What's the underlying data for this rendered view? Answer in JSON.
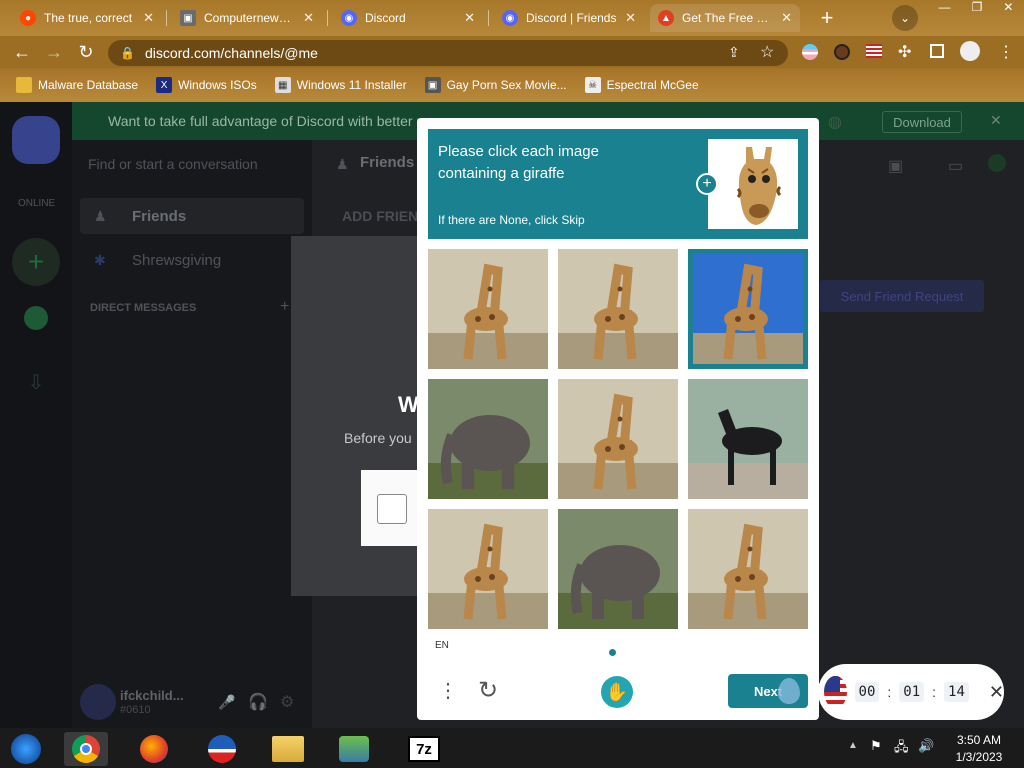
{
  "browser": {
    "tabs": [
      {
        "title": "The true, correct",
        "icon": "reddit-icon",
        "color": "#ff4500"
      },
      {
        "title": "Computernewb's I",
        "icon": "computer-icon",
        "color": "#7a7a7a"
      },
      {
        "title": "Discord",
        "icon": "discord-icon",
        "color": "#5865f2"
      },
      {
        "title": "Discord | Friends",
        "icon": "discord-icon",
        "color": "#5865f2"
      },
      {
        "title": "Get The Free and",
        "icon": "fire-icon",
        "color": "#e04020"
      }
    ],
    "url": "discord.com/channels/@me",
    "bookmarks": [
      {
        "label": "Malware Database",
        "icon": "folder-icon"
      },
      {
        "label": "Windows ISOs",
        "icon": "x-icon"
      },
      {
        "label": "Windows 11 Installer",
        "icon": "image-icon"
      },
      {
        "label": "Gay Porn Sex Movie...",
        "icon": "computer-icon"
      },
      {
        "label": "Espectral McGee",
        "icon": "skull-icon"
      }
    ]
  },
  "discord": {
    "banner": "Want to take full advantage of Discord with better pe",
    "download": "Download",
    "search_placeholder": "Find or start a conversation",
    "friends_header": "Friends",
    "online_label": "ONLINE",
    "nav_friends": "Friends",
    "nav_shrewsgiving": "Shrewsgiving",
    "dm_header": "DIRECT MESSAGES",
    "add_friend": "ADD FRIEND",
    "add_friend_btn": "Send Friend Request",
    "modal_title": "W",
    "modal_sub": "Before you",
    "user_name": "ifckchild...",
    "user_tag": "#0610"
  },
  "captcha": {
    "prompt": "Please click each image containing a giraffe",
    "sub": "If there are None, click Skip",
    "lang": "EN",
    "next_label": "Next",
    "tiles": [
      {
        "subject": "giraffe",
        "selected": false
      },
      {
        "subject": "giraffe",
        "selected": false
      },
      {
        "subject": "giraffe",
        "selected": true
      },
      {
        "subject": "elephant",
        "selected": false
      },
      {
        "subject": "giraffe",
        "selected": false
      },
      {
        "subject": "horse",
        "selected": false
      },
      {
        "subject": "giraffe",
        "selected": false
      },
      {
        "subject": "elephant",
        "selected": false
      },
      {
        "subject": "giraffe",
        "selected": false
      }
    ],
    "accent": "#1a8190"
  },
  "timer": {
    "h": "00",
    "m": "01",
    "s": "14"
  },
  "taskbar": {
    "time": "3:50 AM",
    "date": "1/3/2023"
  }
}
